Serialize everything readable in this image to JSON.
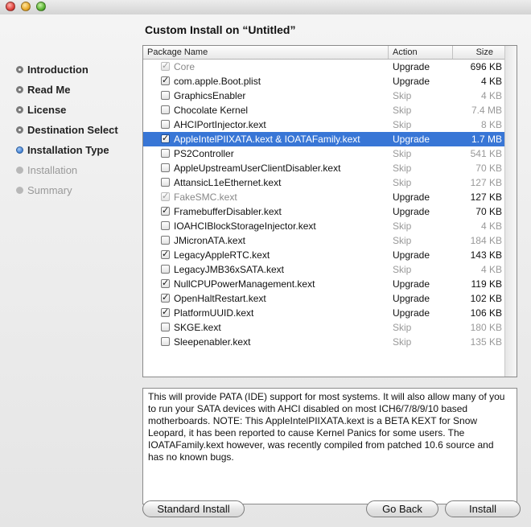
{
  "window": {
    "title": "Custom Install on “Untitled”"
  },
  "sidebar": {
    "steps": [
      {
        "label": "Introduction",
        "state": "done"
      },
      {
        "label": "Read Me",
        "state": "done"
      },
      {
        "label": "License",
        "state": "done"
      },
      {
        "label": "Destination Select",
        "state": "done"
      },
      {
        "label": "Installation Type",
        "state": "current"
      },
      {
        "label": "Installation",
        "state": "pending"
      },
      {
        "label": "Summary",
        "state": "pending"
      }
    ]
  },
  "table": {
    "headers": {
      "name": "Package Name",
      "action": "Action",
      "size": "Size"
    },
    "rows": [
      {
        "name": "Core",
        "checked": true,
        "locked": true,
        "action": "Upgrade",
        "size": "696 KB",
        "skip": false,
        "selected": false
      },
      {
        "name": "com.apple.Boot.plist",
        "checked": true,
        "locked": false,
        "action": "Upgrade",
        "size": "4 KB",
        "skip": false,
        "selected": false
      },
      {
        "name": "GraphicsEnabler",
        "checked": false,
        "locked": false,
        "action": "Skip",
        "size": "4 KB",
        "skip": true,
        "selected": false
      },
      {
        "name": "Chocolate Kernel",
        "checked": false,
        "locked": false,
        "action": "Skip",
        "size": "7.4 MB",
        "skip": true,
        "selected": false
      },
      {
        "name": "AHCIPortInjector.kext",
        "checked": false,
        "locked": false,
        "action": "Skip",
        "size": "8 KB",
        "skip": true,
        "selected": false
      },
      {
        "name": "AppleIntelPIIXATA.kext & IOATAFamily.kext",
        "checked": true,
        "locked": false,
        "action": "Upgrade",
        "size": "1.7 MB",
        "skip": false,
        "selected": true
      },
      {
        "name": "PS2Controller",
        "checked": false,
        "locked": false,
        "action": "Skip",
        "size": "541 KB",
        "skip": true,
        "selected": false
      },
      {
        "name": "AppleUpstreamUserClientDisabler.kext",
        "checked": false,
        "locked": false,
        "action": "Skip",
        "size": "70 KB",
        "skip": true,
        "selected": false
      },
      {
        "name": "AttansicL1eEthernet.kext",
        "checked": false,
        "locked": false,
        "action": "Skip",
        "size": "127 KB",
        "skip": true,
        "selected": false
      },
      {
        "name": "FakeSMC.kext",
        "checked": true,
        "locked": true,
        "action": "Upgrade",
        "size": "127 KB",
        "skip": false,
        "selected": false
      },
      {
        "name": "FramebufferDisabler.kext",
        "checked": true,
        "locked": false,
        "action": "Upgrade",
        "size": "70 KB",
        "skip": false,
        "selected": false
      },
      {
        "name": "IOAHCIBlockStorageInjector.kext",
        "checked": false,
        "locked": false,
        "action": "Skip",
        "size": "4 KB",
        "skip": true,
        "selected": false
      },
      {
        "name": "JMicronATA.kext",
        "checked": false,
        "locked": false,
        "action": "Skip",
        "size": "184 KB",
        "skip": true,
        "selected": false
      },
      {
        "name": "LegacyAppleRTC.kext",
        "checked": true,
        "locked": false,
        "action": "Upgrade",
        "size": "143 KB",
        "skip": false,
        "selected": false
      },
      {
        "name": "LegacyJMB36xSATA.kext",
        "checked": false,
        "locked": false,
        "action": "Skip",
        "size": "4 KB",
        "skip": true,
        "selected": false
      },
      {
        "name": "NullCPUPowerManagement.kext",
        "checked": true,
        "locked": false,
        "action": "Upgrade",
        "size": "119 KB",
        "skip": false,
        "selected": false
      },
      {
        "name": "OpenHaltRestart.kext",
        "checked": true,
        "locked": false,
        "action": "Upgrade",
        "size": "102 KB",
        "skip": false,
        "selected": false
      },
      {
        "name": "PlatformUUID.kext",
        "checked": true,
        "locked": false,
        "action": "Upgrade",
        "size": "106 KB",
        "skip": false,
        "selected": false
      },
      {
        "name": "SKGE.kext",
        "checked": false,
        "locked": false,
        "action": "Skip",
        "size": "180 KB",
        "skip": true,
        "selected": false
      },
      {
        "name": "Sleepenabler.kext",
        "checked": false,
        "locked": false,
        "action": "Skip",
        "size": "135 KB",
        "skip": true,
        "selected": false
      }
    ]
  },
  "description": "This will provide PATA (IDE) support for most systems. It will also allow many of you to run your SATA devices with AHCI disabled on most ICH6/7/8/9/10 based motherboards. NOTE: This AppleIntelPIIXATA.kext is a BETA KEXT for Snow Leopard, it has been reported to cause Kernel Panics for some users. The IOATAFamily.kext however, was recently compiled from patched 10.6 source and has no known bugs.",
  "buttons": {
    "standard_install": "Standard Install",
    "go_back": "Go Back",
    "install": "Install"
  },
  "colors": {
    "selection": "#3876d6",
    "current_step": "#3f7fd4",
    "skip_text": "#999999"
  },
  "icons": {
    "check": "checkmark-icon"
  }
}
